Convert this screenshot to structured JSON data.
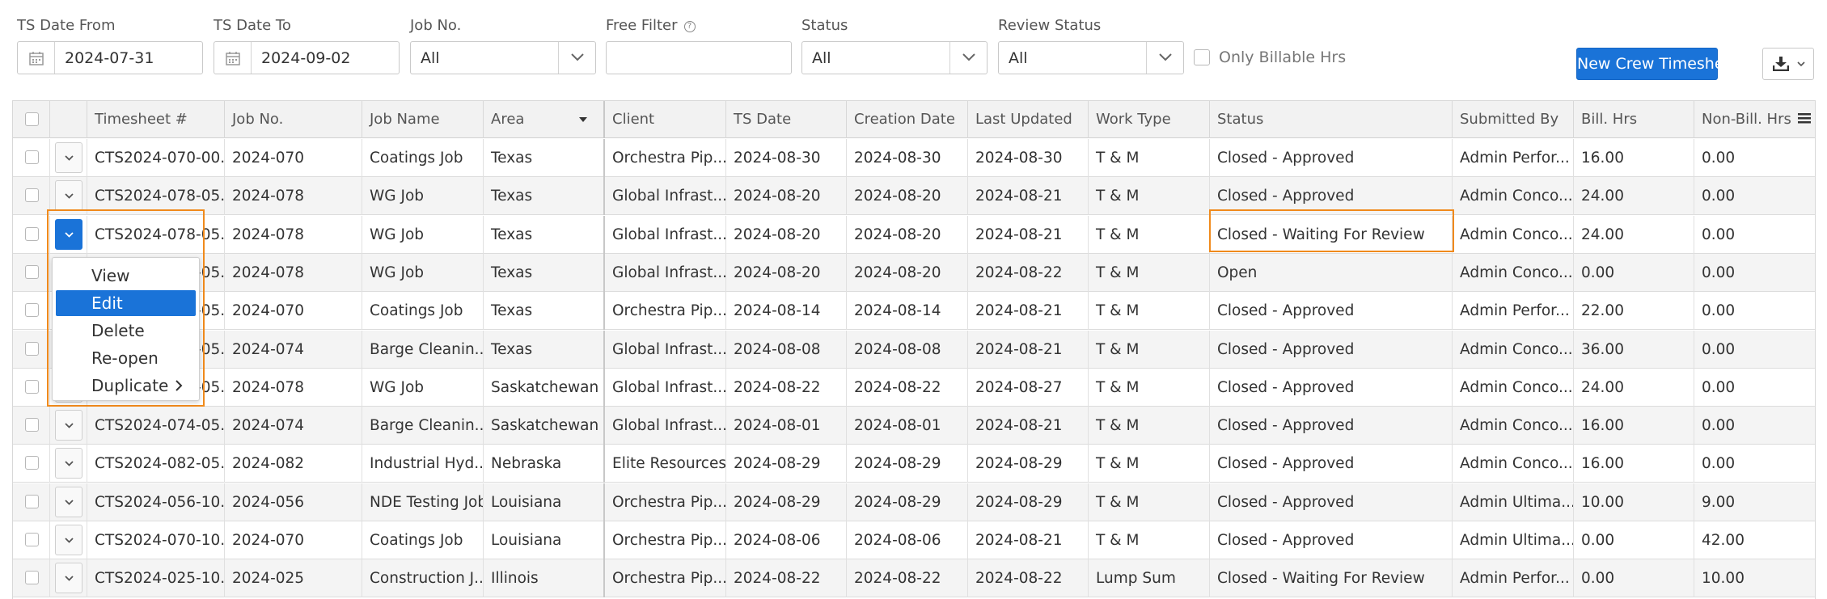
{
  "filters": {
    "ts_date_from": {
      "label": "TS Date From",
      "value": "2024-07-31"
    },
    "ts_date_to": {
      "label": "TS Date To",
      "value": "2024-09-02"
    },
    "job_no": {
      "label": "Job No.",
      "value": "All"
    },
    "free_filter": {
      "label": "Free Filter",
      "value": ""
    },
    "status": {
      "label": "Status",
      "value": "All"
    },
    "review_status": {
      "label": "Review Status",
      "value": "All"
    },
    "only_billable": {
      "label": "Only Billable Hrs",
      "checked": false
    }
  },
  "toolbar": {
    "new_button": "New Crew Timesheet",
    "export_icon": "download-icon"
  },
  "columns": [
    "Timesheet #",
    "Job No.",
    "Job Name",
    "Area",
    "Client",
    "TS Date",
    "Creation Date",
    "Last Updated",
    "Work Type",
    "Status",
    "Submitted By",
    "Bill. Hrs",
    "Non-Bill. Hrs"
  ],
  "rows": [
    [
      "CTS2024-070-00...",
      "2024-070",
      "Coatings Job",
      "Texas",
      "Orchestra Pip...",
      "2024-08-30",
      "2024-08-30",
      "2024-08-30",
      "T & M",
      "Closed - Approved",
      "Admin Perfor...",
      "16.00",
      "0.00"
    ],
    [
      "CTS2024-078-05...",
      "2024-078",
      "WG Job",
      "Texas",
      "Global Infrast...",
      "2024-08-20",
      "2024-08-20",
      "2024-08-21",
      "T & M",
      "Closed - Approved",
      "Admin Conco...",
      "24.00",
      "0.00"
    ],
    [
      "CTS2024-078-05...",
      "2024-078",
      "WG Job",
      "Texas",
      "Global Infrast...",
      "2024-08-20",
      "2024-08-20",
      "2024-08-21",
      "T & M",
      "Closed - Waiting For Review",
      "Admin Conco...",
      "24.00",
      "0.00"
    ],
    [
      "CTS2024-078-05...",
      "2024-078",
      "WG Job",
      "Texas",
      "Global Infrast...",
      "2024-08-20",
      "2024-08-20",
      "2024-08-22",
      "T & M",
      "Open",
      "Admin Conco...",
      "0.00",
      "0.00"
    ],
    [
      "CTS2024-070-05...",
      "2024-070",
      "Coatings Job",
      "Texas",
      "Orchestra Pip...",
      "2024-08-14",
      "2024-08-14",
      "2024-08-21",
      "T & M",
      "Closed - Approved",
      "Admin Perfor...",
      "22.00",
      "0.00"
    ],
    [
      "CTS2024-074-05...",
      "2024-074",
      "Barge Cleanin...",
      "Texas",
      "Global Infrast...",
      "2024-08-08",
      "2024-08-08",
      "2024-08-21",
      "T & M",
      "Closed - Approved",
      "Admin Conco...",
      "36.00",
      "0.00"
    ],
    [
      "CTS2024-078-05...",
      "2024-078",
      "WG Job",
      "Saskatchewan",
      "Global Infrast...",
      "2024-08-22",
      "2024-08-22",
      "2024-08-27",
      "T & M",
      "Closed - Approved",
      "Admin Conco...",
      "24.00",
      "0.00"
    ],
    [
      "CTS2024-074-05...",
      "2024-074",
      "Barge Cleanin...",
      "Saskatchewan",
      "Global Infrast...",
      "2024-08-01",
      "2024-08-01",
      "2024-08-21",
      "T & M",
      "Closed - Approved",
      "Admin Conco...",
      "16.00",
      "0.00"
    ],
    [
      "CTS2024-082-05...",
      "2024-082",
      "Industrial Hyd...",
      "Nebraska",
      "Elite Resources",
      "2024-08-29",
      "2024-08-29",
      "2024-08-29",
      "T & M",
      "Closed - Approved",
      "Admin Conco...",
      "16.00",
      "0.00"
    ],
    [
      "CTS2024-056-10...",
      "2024-056",
      "NDE Testing Job",
      "Louisiana",
      "Orchestra Pip...",
      "2024-08-29",
      "2024-08-29",
      "2024-08-29",
      "T & M",
      "Closed - Approved",
      "Admin Ultima...",
      "10.00",
      "9.00"
    ],
    [
      "CTS2024-070-10...",
      "2024-070",
      "Coatings Job",
      "Louisiana",
      "Orchestra Pip...",
      "2024-08-06",
      "2024-08-06",
      "2024-08-21",
      "T & M",
      "Closed - Approved",
      "Admin Ultima...",
      "0.00",
      "42.00"
    ],
    [
      "CTS2024-025-10...",
      "2024-025",
      "Construction J...",
      "Illinois",
      "Orchestra Pip...",
      "2024-08-22",
      "2024-08-22",
      "2024-08-22",
      "Lump Sum",
      "Closed - Waiting For Review",
      "Admin Perfor...",
      "0.00",
      "10.00"
    ]
  ],
  "context_menu": {
    "items": [
      "View",
      "Edit",
      "Delete",
      "Re-open",
      "Duplicate"
    ],
    "selected": "Edit",
    "active_row": 3
  },
  "colors": {
    "primary": "#1a73d8",
    "highlight": "#f08a1c"
  }
}
